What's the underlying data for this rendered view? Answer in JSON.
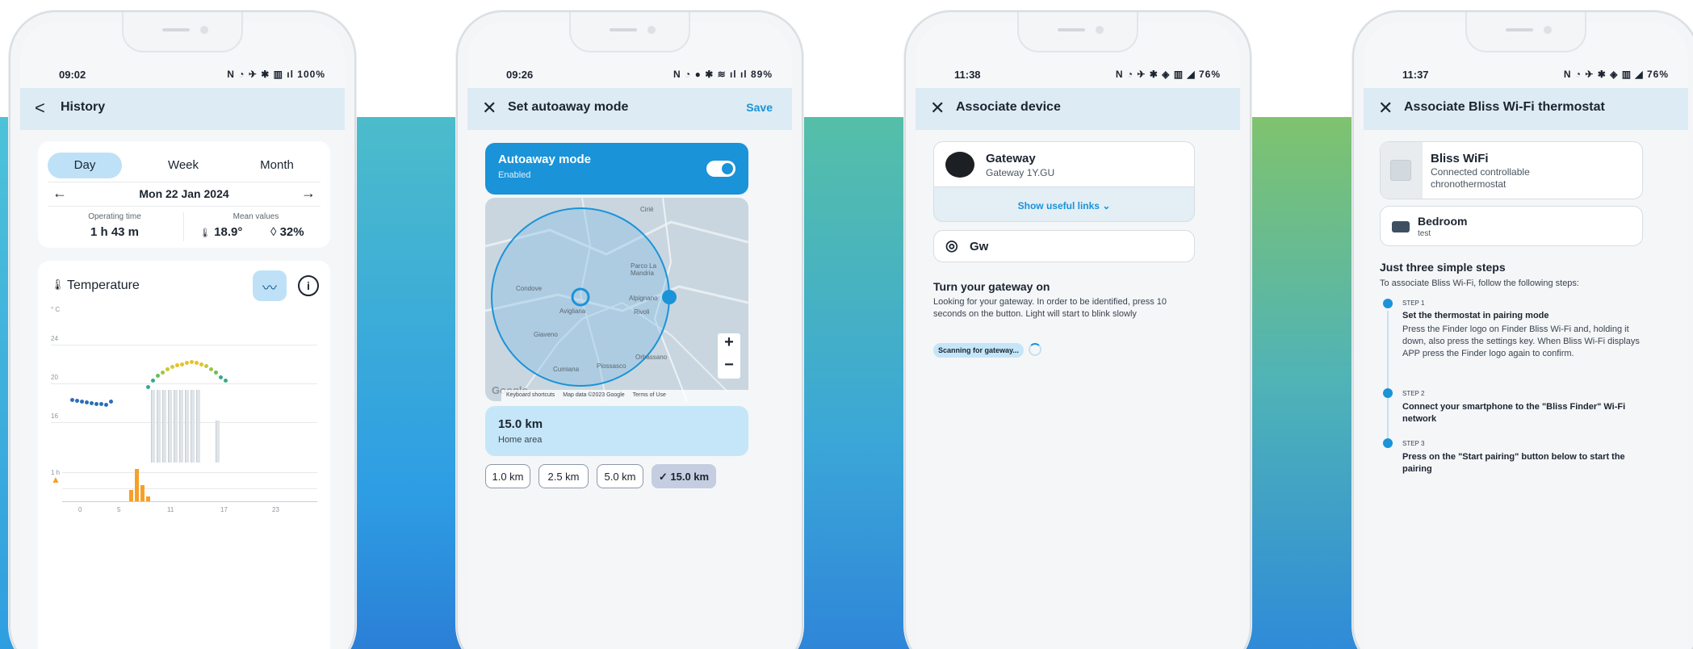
{
  "phone1": {
    "status": {
      "time": "09:02",
      "icons": "N ◔ ✈ ✱ ▥ ıl 100%"
    },
    "appbar": {
      "back": "<",
      "title": "History"
    },
    "segments": [
      "Day",
      "Week",
      "Month"
    ],
    "date": {
      "prev": "←",
      "label": "Mon 22 Jan 2024",
      "next": "→"
    },
    "operating": {
      "label": "Operating time",
      "value": "1 h 43 m"
    },
    "mean": {
      "label": "Mean values",
      "temp": "18.9°",
      "humidity": "32%"
    },
    "chart": {
      "title": "Temperature",
      "unit": "° C",
      "y_ticks": [
        "24",
        "20",
        "16"
      ],
      "x_ticks": [
        "0",
        "5",
        "11",
        "17",
        "23"
      ],
      "hours_label": "1 h"
    }
  },
  "phone2": {
    "status": {
      "time": "09:26",
      "icons": "N ◔ ● ✱ ≋ ıl ıl 89%"
    },
    "appbar": {
      "close": "✕",
      "title": "Set autoaway mode",
      "save": "Save"
    },
    "autoaway": {
      "title": "Autoaway mode",
      "sub": "Enabled",
      "on": true
    },
    "map": {
      "places": [
        "Cirié",
        "Parco La Mandria",
        "Condove",
        "Avigliana",
        "Alpignano",
        "Rivoli",
        "Giaveno",
        "Orbassano",
        "Cumiana",
        "Piossasco"
      ],
      "footer": [
        "Keyboard shortcuts",
        "Map data ©2023 Google",
        "Terms of Use"
      ],
      "zoom_in": "+",
      "zoom_out": "−",
      "logo": "Google"
    },
    "home_area": {
      "value": "15.0 km",
      "label": "Home area"
    },
    "chips": [
      "1.0 km",
      "2.5 km",
      "5.0 km",
      "✓ 15.0 km"
    ]
  },
  "phone3": {
    "status": {
      "time": "11:38",
      "icons": "N ◔ ✈ ✱ ◈ ▥ ◢ 76%"
    },
    "appbar": {
      "close": "✕",
      "title": "Associate device"
    },
    "gateway": {
      "name": "Gateway",
      "sub": "Gateway 1Y.GU",
      "links": "Show useful links"
    },
    "gw": {
      "name": "Gw"
    },
    "heading": "Turn your gateway on",
    "body": "Looking for your gateway. In order to be identified, press 10 seconds on the button. Light will start to blink slowly",
    "scan": "Scanning for gateway..."
  },
  "phone4": {
    "status": {
      "time": "11:37",
      "icons": "N ◔ ✈ ✱ ◈ ▥ ◢ 76%"
    },
    "appbar": {
      "close": "✕",
      "title": "Associate Bliss Wi-Fi thermostat"
    },
    "device": {
      "name": "Bliss WiFi",
      "sub": "Connected controllable chronothermostat"
    },
    "room": {
      "name": "Bedroom",
      "sub": "test"
    },
    "heading": "Just three simple steps",
    "intro": "To associate Bliss Wi-Fi, follow the following steps:",
    "steps": [
      {
        "label": "STEP 1",
        "title": "Set the thermostat in pairing mode",
        "body": "Press the Finder logo on Finder Bliss Wi-Fi and, holding it down, also press the settings key. When Bliss Wi-Fi displays APP press the Finder logo again to confirm."
      },
      {
        "label": "STEP 2",
        "title": "Connect your smartphone to the \"Bliss Finder\" Wi-Fi network",
        "body": ""
      },
      {
        "label": "STEP 3",
        "title": "Press on the \"Start pairing\" button below to start the pairing",
        "body": ""
      }
    ]
  }
}
